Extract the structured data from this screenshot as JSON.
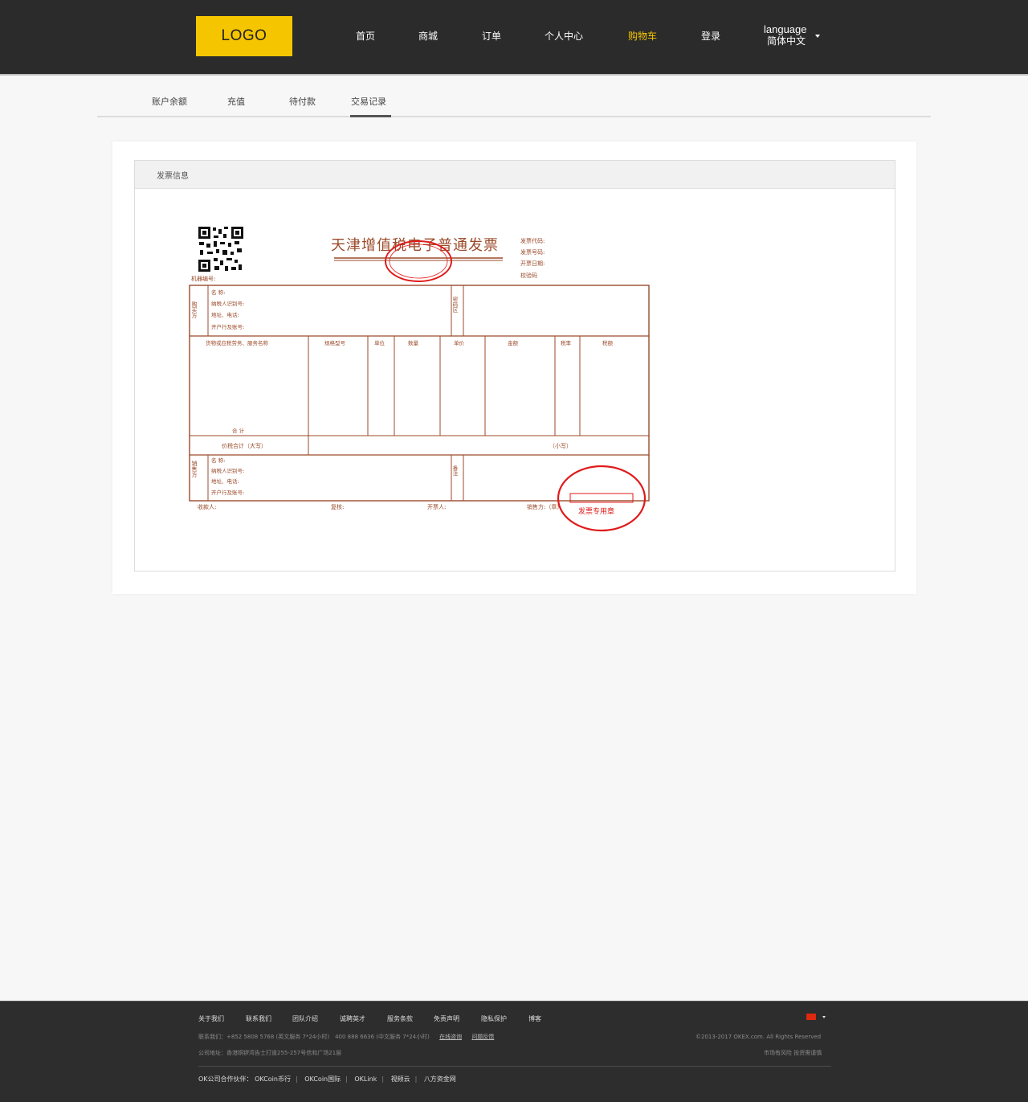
{
  "header": {
    "logo": "LOGO",
    "nav": [
      "首页",
      "商城",
      "订单",
      "个人中心",
      "购物车",
      "登录"
    ],
    "active_nav": "购物车",
    "language_label": "language",
    "language_value": "简体中文"
  },
  "subtabs": [
    "账户余额",
    "充值",
    "待付款",
    "交易记录"
  ],
  "active_subtab": "交易记录",
  "panel": {
    "title": "发票信息"
  },
  "invoice": {
    "title": "天津增值税电子普通发票",
    "meta": [
      "发票代码:",
      "发票号码:",
      "开票日期:",
      "校验码"
    ],
    "machine_no": "机器编号:",
    "buyer_label": "购买方",
    "party_fields": [
      "名 称:",
      "纳税人识别号:",
      "地址、电话:",
      "开户行及账号:"
    ],
    "password_area": "密码区",
    "columns": [
      "货物或应税劳务、服务名称",
      "规格型号",
      "单位",
      "数量",
      "单价",
      "金额",
      "税率",
      "税额"
    ],
    "total_label": "合 计",
    "grand_total_label": "价税合计（大写）",
    "lowercase_label": "（小写）",
    "seller_label": "销售方",
    "remarks_label": "备注",
    "signatures": [
      "收款人:",
      "复核:",
      "开票人:",
      "销售方:（章）"
    ],
    "seal_text": "发票专用章",
    "ink_color": "#9b4a2a",
    "seal_color": "#e01a1a"
  },
  "footer": {
    "links": [
      "关于我们",
      "联系我们",
      "团队介绍",
      "诚聘英才",
      "服务条款",
      "免责声明",
      "隐私保护",
      "博客"
    ],
    "contact": "联系我们：+852 5808 5768 (英文服务 7*24小时)　400 888 6636 (中文服务 7*24小时)",
    "contact_links": [
      "在线咨询",
      "问题反馈"
    ],
    "address": "公司地址：香港铜锣湾告士打道255-257号信和广场21层",
    "copyright": "©2013-2017 OKEX.com. All Rights Reserved",
    "risk": "市场有风险 投资需谨慎",
    "partners_label": "OK公司合作伙伴：",
    "partners": [
      "OKCoin币行",
      "OKCoin国际",
      "OKLink",
      "视频云",
      "八方资金网"
    ]
  }
}
